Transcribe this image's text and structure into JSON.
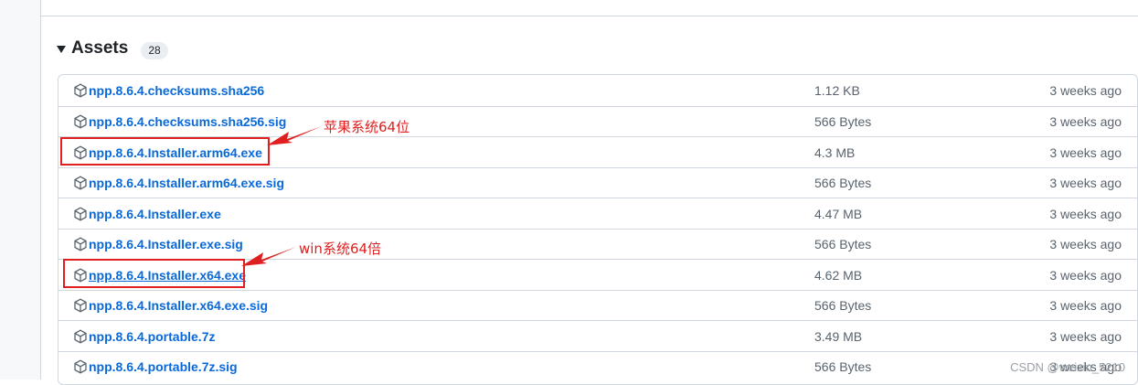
{
  "assets": {
    "title": "Assets",
    "count": "28",
    "items": [
      {
        "name": "npp.8.6.4.checksums.sha256",
        "size": "1.12 KB",
        "time": "3 weeks ago"
      },
      {
        "name": "npp.8.6.4.checksums.sha256.sig",
        "size": "566 Bytes",
        "time": "3 weeks ago"
      },
      {
        "name": "npp.8.6.4.Installer.arm64.exe",
        "size": "4.3 MB",
        "time": "3 weeks ago"
      },
      {
        "name": "npp.8.6.4.Installer.arm64.exe.sig",
        "size": "566 Bytes",
        "time": "3 weeks ago"
      },
      {
        "name": "npp.8.6.4.Installer.exe",
        "size": "4.47 MB",
        "time": "3 weeks ago"
      },
      {
        "name": "npp.8.6.4.Installer.exe.sig",
        "size": "566 Bytes",
        "time": "3 weeks ago"
      },
      {
        "name": "npp.8.6.4.Installer.x64.exe",
        "size": "4.62 MB",
        "time": "3 weeks ago"
      },
      {
        "name": "npp.8.6.4.Installer.x64.exe.sig",
        "size": "566 Bytes",
        "time": "3 weeks ago"
      },
      {
        "name": "npp.8.6.4.portable.7z",
        "size": "3.49 MB",
        "time": "3 weeks ago"
      },
      {
        "name": "npp.8.6.4.portable.7z.sig",
        "size": "566 Bytes",
        "time": "3 weeks ago"
      }
    ]
  },
  "annotations": {
    "arm64_note": "苹果系统64位",
    "x64_note": "win系统64倍"
  },
  "watermark": "CSDN @weixin_5210",
  "colors": {
    "link": "#0969da",
    "annotation_red": "#e02020",
    "muted_text": "#59636e",
    "border": "#d0d7de"
  }
}
